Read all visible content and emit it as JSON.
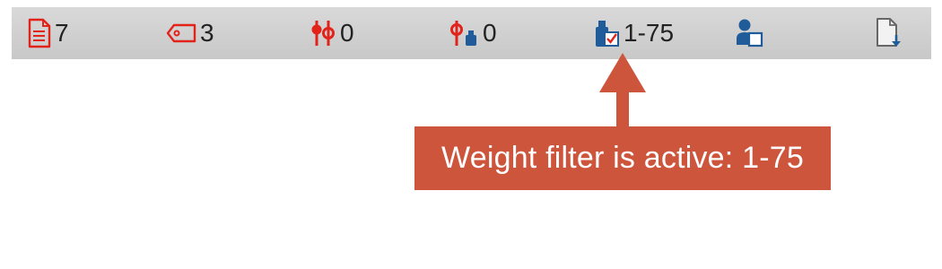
{
  "statusbar": {
    "documents": {
      "icon": "document-icon",
      "count": "7"
    },
    "tags": {
      "icon": "tag-icon",
      "count": "3"
    },
    "chains": {
      "icon": "connector-chain-icon",
      "count": "0"
    },
    "weights_linked": {
      "icon": "connector-weight-icon",
      "count": "0"
    },
    "weight_filter": {
      "icon": "weight-filter-icon",
      "value": "1-75"
    },
    "user_filter": {
      "icon": "user-filter-icon"
    },
    "export": {
      "icon": "export-document-icon"
    }
  },
  "callout": {
    "text": "Weight filter is active: 1-75"
  },
  "colors": {
    "red": "#e2231a",
    "blue": "#1f5c99",
    "callout": "#cd553c"
  }
}
